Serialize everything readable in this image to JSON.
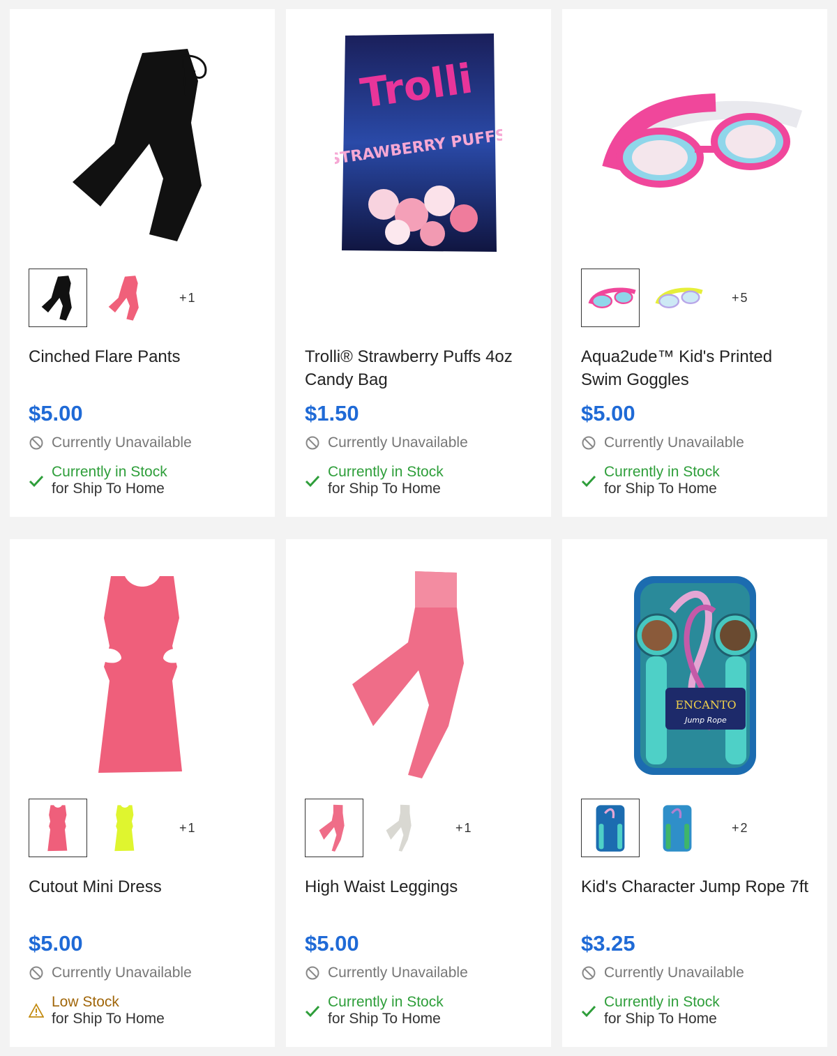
{
  "products": [
    {
      "title": "Cinched Flare Pants",
      "price": "$5.00",
      "hero_icon": "black-flare-pants",
      "swatches": [
        "black",
        "pink"
      ],
      "more": "+1",
      "availability": "Currently Unavailable",
      "ship_status": "Currently in Stock",
      "ship_sub": "for Ship To Home"
    },
    {
      "title": "Trolli® Strawberry Puffs 4oz Candy Bag",
      "price": "$1.50",
      "hero_icon": "trolli-candy-bag",
      "hero_text": "Trolli",
      "hero_subtext": "STRAWBERRY PUFFS",
      "swatches": [],
      "more": "",
      "availability": "Currently Unavailable",
      "ship_status": "Currently in Stock",
      "ship_sub": "for Ship To Home"
    },
    {
      "title": "Aqua2ude™ Kid's Printed Swim Goggles",
      "price": "$5.00",
      "hero_icon": "pink-swim-goggles",
      "swatches": [
        "pink-blue",
        "yellow-blue"
      ],
      "more": "+5",
      "availability": "Currently Unavailable",
      "ship_status": "Currently in Stock",
      "ship_sub": "for Ship To Home"
    },
    {
      "title": "Cutout Mini Dress",
      "price": "$5.00",
      "hero_icon": "pink-cutout-dress",
      "swatches": [
        "pink",
        "neon-yellow"
      ],
      "more": "+1",
      "availability": "Currently Unavailable",
      "ship_status": "Low Stock",
      "ship_sub": "for Ship To Home"
    },
    {
      "title": "High Waist Leggings",
      "price": "$5.00",
      "hero_icon": "pink-leggings",
      "swatches": [
        "pink",
        "light-gray"
      ],
      "more": "+1",
      "availability": "Currently Unavailable",
      "ship_status": "Currently in Stock",
      "ship_sub": "for Ship To Home"
    },
    {
      "title": "Kid's Character Jump Rope 7ft",
      "price": "$3.25",
      "hero_icon": "encanto-jump-rope",
      "hero_text": "ENCANTO",
      "hero_subtext": "Jump Rope",
      "swatches": [
        "encanto",
        "character-2"
      ],
      "more": "+2",
      "availability": "Currently Unavailable",
      "ship_status": "Currently in Stock",
      "ship_sub": "for Ship To Home"
    }
  ],
  "colors": {
    "price": "#1f6ad6",
    "in_stock": "#2e9e3a",
    "low_stock": "#a0660a",
    "unavailable": "#777777",
    "pink": "#f0607a",
    "black": "#111111"
  }
}
